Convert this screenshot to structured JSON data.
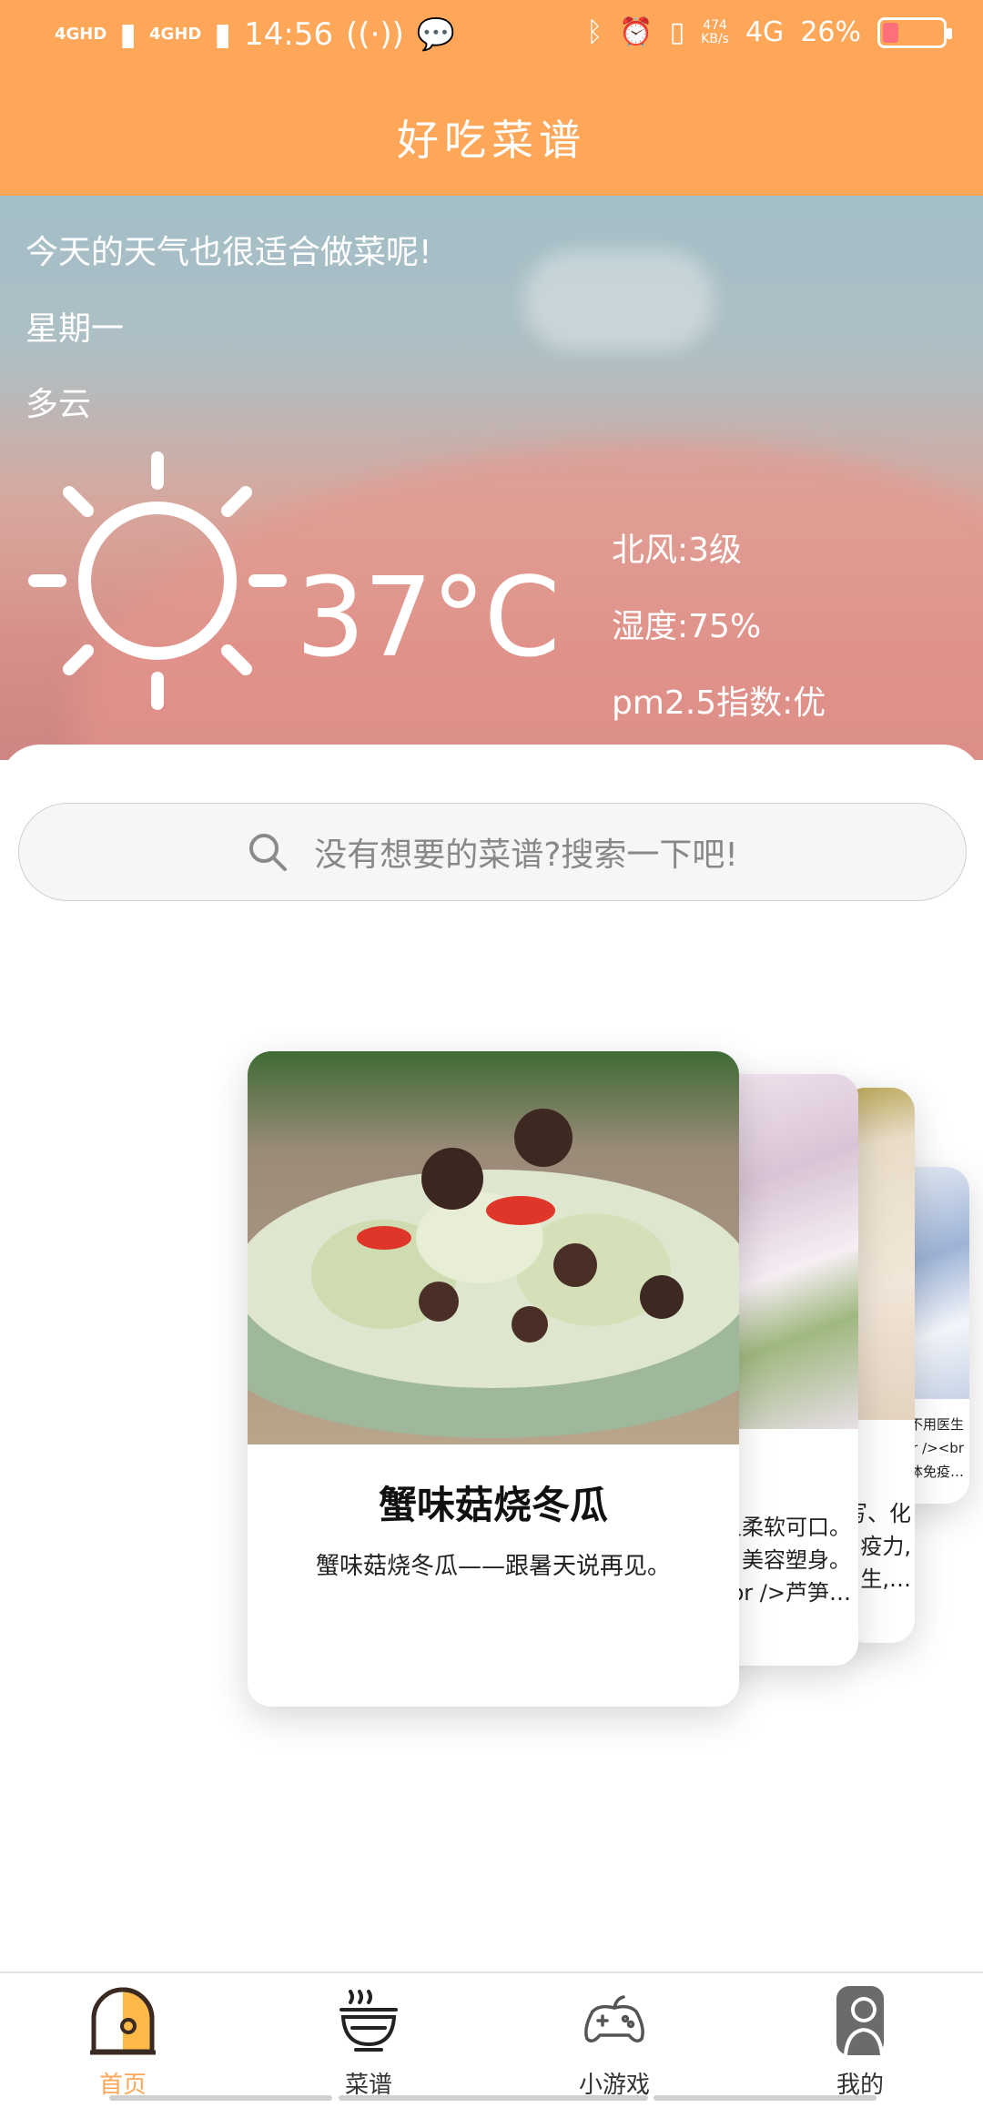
{
  "status_bar": {
    "network_1": "4GHD",
    "network_2": "4GHD",
    "time": "14:56",
    "speed": "474\nKB/s",
    "net_type": "4G",
    "battery_text": "26%",
    "battery_level": 0.26
  },
  "app": {
    "title": "好吃菜谱"
  },
  "weather": {
    "greeting": "今天的天气也很适合做菜呢!",
    "weekday": "星期一",
    "condition": "多云",
    "temperature": "37°C",
    "wind": "北风:3级",
    "humidity": "湿度:75%",
    "pm25": "pm2.5指数:优"
  },
  "search": {
    "placeholder": "没有想要的菜谱?搜索一下吧!"
  },
  "cards": [
    {
      "title": "蟹味菇烧冬瓜",
      "desc": "蟹味菇烧冬瓜——跟暑天说再见。"
    },
    {
      "title": "",
      "desc_lines": [
        "且柔软可口。",
        "美容塑身。",
        "br />芦笋…"
      ]
    },
    {
      "title": "",
      "desc_lines": [
        "写、化",
        "疫力,",
        "生,…"
      ]
    },
    {
      "title": "",
      "desc_lines": [
        "不用医生",
        "<br /><br",
        "机体免疫…"
      ]
    }
  ],
  "nav": {
    "items": [
      {
        "label": "首页",
        "icon": "home-icon",
        "active": true
      },
      {
        "label": "菜谱",
        "icon": "bowl-icon",
        "active": false
      },
      {
        "label": "小游戏",
        "icon": "gamepad-icon",
        "active": false
      },
      {
        "label": "我的",
        "icon": "profile-icon",
        "active": false
      }
    ]
  },
  "colors": {
    "accent": "#FEA759",
    "battery_low": "#ff6f7a"
  }
}
